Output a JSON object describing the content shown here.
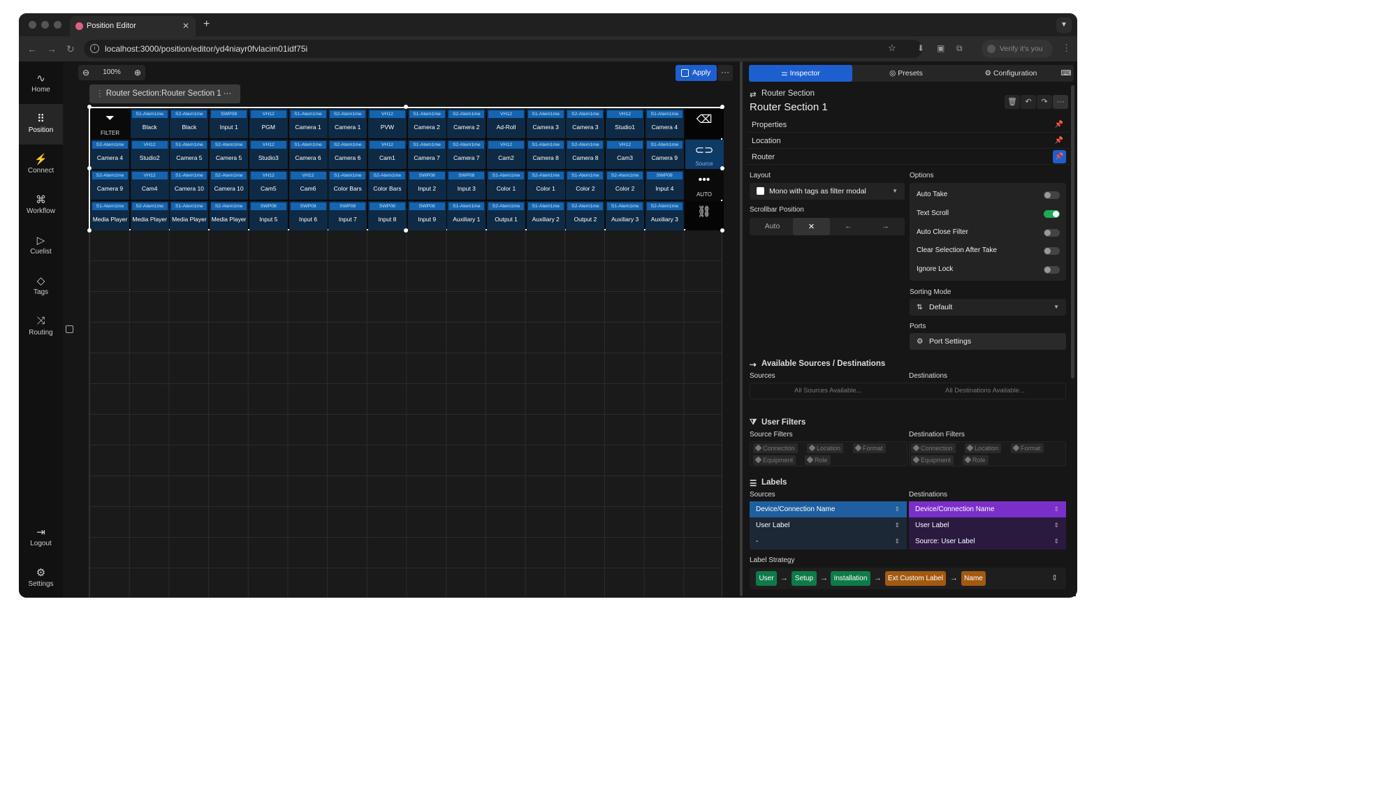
{
  "browser": {
    "tab_title": "Position Editor",
    "url": "localhost:3000/position/editor/yd4niayr0fvlacim01idf75i",
    "verify_label": "Verify it's you"
  },
  "sidebar": {
    "items": [
      {
        "label": "Home",
        "icon": "activity-icon"
      },
      {
        "label": "Position",
        "icon": "grid-icon"
      },
      {
        "label": "Connect",
        "icon": "plug-icon"
      },
      {
        "label": "Workflow",
        "icon": "workflow-icon"
      },
      {
        "label": "Cuelist",
        "icon": "play-icon"
      },
      {
        "label": "Tags",
        "icon": "tag-icon"
      },
      {
        "label": "Routing",
        "icon": "shuffle-icon"
      }
    ],
    "bottom": [
      {
        "label": "Logout",
        "icon": "logout-icon"
      },
      {
        "label": "Settings",
        "icon": "settings-icon"
      }
    ]
  },
  "toolbar": {
    "zoom": "100%",
    "apply_label": "Apply",
    "section_tag": "Router Section:Router Section 1"
  },
  "router": {
    "colors": {
      "cell_bg": "#0e2a45",
      "tag_bg": "#1464b0",
      "selected_bg": "#0e3a66"
    },
    "side_buttons": [
      "FILTER",
      "Source",
      "AUTO"
    ],
    "rows": [
      [
        {
          "tag": "S1-Atem1me",
          "label": "Black"
        },
        {
          "tag": "S2-Atem1me",
          "label": "Black"
        },
        {
          "tag": "SWP08",
          "label": "Input 1"
        },
        {
          "tag": "VH12",
          "label": "PGM"
        },
        {
          "tag": "S1-Atem1me",
          "label": "Camera 1"
        },
        {
          "tag": "S2-Atem1me",
          "label": "Camera 1"
        },
        {
          "tag": "VH12",
          "label": "PVW"
        },
        {
          "tag": "S1-Atem1me",
          "label": "Camera 2"
        },
        {
          "tag": "S2-Atem1me",
          "label": "Camera 2"
        },
        {
          "tag": "VH12",
          "label": "Ad-Roll"
        },
        {
          "tag": "S1-Atem1me",
          "label": "Camera 3"
        },
        {
          "tag": "S2-Atem1me",
          "label": "Camera 3"
        },
        {
          "tag": "VH12",
          "label": "Studio1"
        },
        {
          "tag": "S1-Atem1me",
          "label": "Camera 4"
        }
      ],
      [
        {
          "tag": "S2-Atem1me",
          "label": "Camera 4"
        },
        {
          "tag": "VH12",
          "label": "Studio2"
        },
        {
          "tag": "S1-Atem1me",
          "label": "Camera 5"
        },
        {
          "tag": "S2-Atem1me",
          "label": "Camera 5"
        },
        {
          "tag": "VH12",
          "label": "Studio3"
        },
        {
          "tag": "S1-Atem1me",
          "label": "Camera 6"
        },
        {
          "tag": "S2-Atem1me",
          "label": "Camera 6"
        },
        {
          "tag": "VH12",
          "label": "Cam1"
        },
        {
          "tag": "S1-Atem1me",
          "label": "Camera 7"
        },
        {
          "tag": "S2-Atem1me",
          "label": "Camera 7"
        },
        {
          "tag": "VH12",
          "label": "Cam2"
        },
        {
          "tag": "S1-Atem1me",
          "label": "Camera 8"
        },
        {
          "tag": "S2-Atem1me",
          "label": "Camera 8"
        },
        {
          "tag": "VH12",
          "label": "Cam3"
        },
        {
          "tag": "S1-Atem1me",
          "label": "Camera 9"
        }
      ],
      [
        {
          "tag": "S2-Atem1me",
          "label": "Camera 9"
        },
        {
          "tag": "VH12",
          "label": "Cam4"
        },
        {
          "tag": "S1-Atem1me",
          "label": "Camera 10"
        },
        {
          "tag": "S2-Atem1me",
          "label": "Camera 10"
        },
        {
          "tag": "VH12",
          "label": "Cam5"
        },
        {
          "tag": "VH12",
          "label": "Cam6"
        },
        {
          "tag": "S1-Atem1me",
          "label": "Color Bars"
        },
        {
          "tag": "S2-Atem1me",
          "label": "Color Bars"
        },
        {
          "tag": "SWP08",
          "label": "Input 2"
        },
        {
          "tag": "SWP08",
          "label": "Input 3"
        },
        {
          "tag": "S1-Atem1me",
          "label": "Color 1"
        },
        {
          "tag": "S2-Atem1me",
          "label": "Color 1"
        },
        {
          "tag": "S1-Atem1me",
          "label": "Color 2"
        },
        {
          "tag": "S2-Atem1me",
          "label": "Color 2"
        },
        {
          "tag": "SWP08",
          "label": "Input 4"
        }
      ],
      [
        {
          "tag": "S1-Atem1me",
          "label": "Media Player"
        },
        {
          "tag": "S2-Atem1me",
          "label": "Media Player"
        },
        {
          "tag": "S1-Atem1me",
          "label": "Media Player"
        },
        {
          "tag": "S2-Atem1me",
          "label": "Media Player"
        },
        {
          "tag": "SWP08",
          "label": "Input 5"
        },
        {
          "tag": "SWP08",
          "label": "Input 6"
        },
        {
          "tag": "SWP08",
          "label": "Input 7"
        },
        {
          "tag": "SWP08",
          "label": "Input 8"
        },
        {
          "tag": "SWP08",
          "label": "Input 9"
        },
        {
          "tag": "S1-Atem1me",
          "label": "Auxiliary 1"
        },
        {
          "tag": "S2-Atem1me",
          "label": "Output 1"
        },
        {
          "tag": "S1-Atem1me",
          "label": "Auxiliary 2"
        },
        {
          "tag": "S2-Atem1me",
          "label": "Output 2"
        },
        {
          "tag": "S1-Atem1me",
          "label": "Auxiliary 3"
        },
        {
          "tag": "S2-Atem1me",
          "label": "Auxiliary 3"
        }
      ]
    ]
  },
  "inspector": {
    "tabs": [
      "Inspector",
      "Presets",
      "Configuration"
    ],
    "kind": "Router Section",
    "name": "Router Section 1",
    "sections": [
      "Properties",
      "Location",
      "Router"
    ],
    "layout_label": "Layout",
    "layout_value": "Mono with tags as filter modal",
    "scrollbar_label": "Scrollbar Position",
    "scrollbar_options": [
      "Auto",
      "×",
      "←",
      "→"
    ],
    "options_label": "Options",
    "options": [
      {
        "label": "Auto Take",
        "on": false
      },
      {
        "label": "Text Scroll",
        "on": true
      },
      {
        "label": "Auto Close Filter",
        "on": false
      },
      {
        "label": "Clear Selection After Take",
        "on": false
      },
      {
        "label": "Ignore Lock",
        "on": false
      }
    ],
    "sorting_label": "Sorting Mode",
    "sorting_value": "Default",
    "ports_label": "Ports",
    "ports_button": "Port Settings",
    "available_title": "Available Sources / Destinations",
    "sources_label": "Sources",
    "destinations_label": "Destinations",
    "all_sources": "All Sources Available...",
    "all_destinations": "All Destinations Available...",
    "user_filters_title": "User Filters",
    "source_filters_label": "Source Filters",
    "destination_filters_label": "Destination Filters",
    "filter_chips": [
      "Connection",
      "Location",
      "Format",
      "Equipment",
      "Role"
    ],
    "labels_title": "Labels",
    "source_labels": [
      "Device/Connection Name",
      "User Label",
      "-"
    ],
    "destination_labels": [
      "Device/Connection Name",
      "User Label",
      "Source: User Label"
    ],
    "label_strategy_label": "Label Strategy",
    "strategy": [
      {
        "label": "User",
        "color": "#0e7a4a"
      },
      {
        "label": "Setup",
        "color": "#0e7a4a"
      },
      {
        "label": "Installation",
        "color": "#0e7a4a"
      },
      {
        "label": "Ext Custom Label",
        "color": "#a35a10"
      },
      {
        "label": "Name",
        "color": "#a35a10"
      }
    ],
    "colors": {
      "accent": "#1e5fcf",
      "source_select": "#1f5f9f",
      "dest_select": "#7b2fc9",
      "dest_bg": "#2a1a40"
    }
  }
}
